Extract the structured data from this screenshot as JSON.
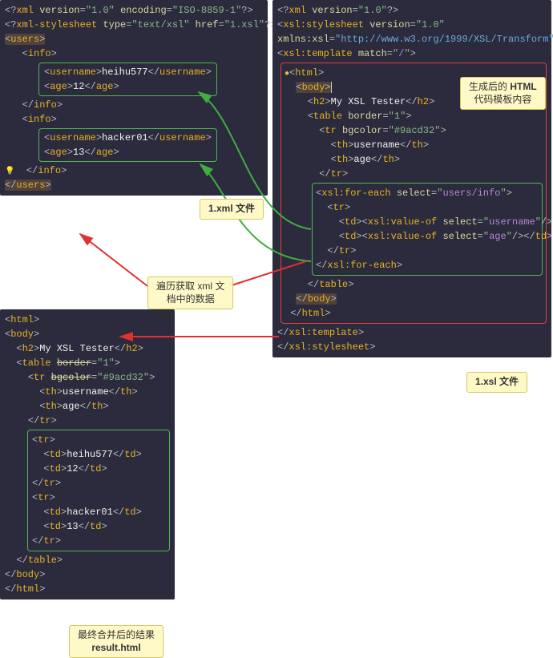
{
  "xml_panel": {
    "decl_attr1": "version",
    "decl_val1": "1.0",
    "decl_attr2": "encoding",
    "decl_val2": "ISO-8859-1",
    "stylesheet_attr1": "type",
    "stylesheet_val1": "text/xsl",
    "stylesheet_attr2": "href",
    "stylesheet_val2": "1.xsl",
    "root": "users",
    "info": "info",
    "username_tag": "username",
    "age_tag": "age",
    "user1_name": "heihu577",
    "user1_age": "12",
    "user2_name": "hacker01",
    "user2_age": "13"
  },
  "xsl_panel": {
    "decl_attr1": "version",
    "decl_val1": "1.0",
    "ss_tag": "xsl:stylesheet",
    "ss_ver_attr": "version",
    "ss_ver_val": "1.0",
    "ns_attr": "xmlns:xsl",
    "ns_val": "http://www.w3.org/1999/XSL/Transform",
    "template_tag": "xsl:template",
    "match_attr": "match",
    "match_val": "/",
    "html": "html",
    "body": "body",
    "h2_tag": "h2",
    "h2_text": "My XSL Tester",
    "table": "table",
    "border_attr": "border",
    "border_val": "1",
    "tr": "tr",
    "bgcolor_attr": "bgcolor",
    "bgcolor_val": "#9acd32",
    "th": "th",
    "th1_text": "username",
    "th2_text": "age",
    "foreach_tag": "xsl:for-each",
    "select_attr": "select",
    "foreach_val_a": "users",
    "foreach_val_b": "info",
    "td": "td",
    "valueof_tag": "xsl:value-of",
    "vo1_val": "username",
    "vo2_val": "age"
  },
  "result_panel": {
    "html": "html",
    "body": "body",
    "h2_tag": "h2",
    "h2_text": "My XSL Tester",
    "table": "table",
    "border_attr": "border",
    "border_val": "1",
    "tr": "tr",
    "bgcolor_attr": "bgcolor",
    "bgcolor_val": "#9acd32",
    "th": "th",
    "th1_text": "username",
    "th2_text": "age",
    "td": "td",
    "r1c1": "heihu577",
    "r1c2": "12",
    "r2c1": "hacker01",
    "r2c2": "13"
  },
  "callouts": {
    "xml_file": "1.xml 文件",
    "xsl_file": "1.xsl 文件",
    "loop_line1": "遍历获取 xml 文",
    "loop_line2": "档中的数据",
    "template_line1": "生成后的 ",
    "template_bold": "HTML",
    "template_line2": "代码模板内容",
    "result_line1": "最终合并后的结果",
    "result_bold": "result.html"
  }
}
